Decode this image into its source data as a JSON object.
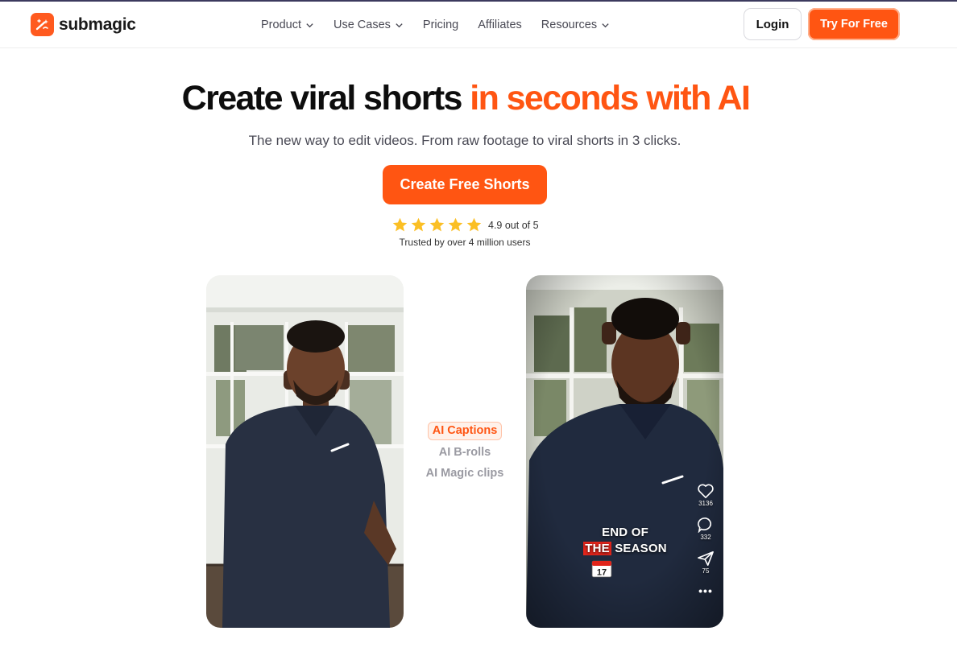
{
  "brand": {
    "name": "submagic",
    "accent": "#ff5512"
  },
  "nav": {
    "items": [
      {
        "label": "Product",
        "dropdown": true
      },
      {
        "label": "Use Cases",
        "dropdown": true
      },
      {
        "label": "Pricing",
        "dropdown": false
      },
      {
        "label": "Affiliates",
        "dropdown": false
      },
      {
        "label": "Resources",
        "dropdown": true
      }
    ],
    "login_label": "Login",
    "try_label": "Try For Free"
  },
  "hero": {
    "title_main": "Create viral shorts",
    "title_accent": "in seconds with AI",
    "subtitle": "The new way to edit videos. From raw footage to viral shorts in 3 clicks.",
    "cta_label": "Create Free Shorts",
    "rating_text": "4.9 out of 5",
    "stars": 5,
    "trusted_text": "Trusted by over 4 million users"
  },
  "features": {
    "active": "AI Captions",
    "items": [
      "AI B-rolls",
      "AI Magic clips"
    ]
  },
  "video_right": {
    "caption_line1": "END OF",
    "caption_highlight": "THE",
    "caption_line2_rest": "SEASON",
    "calendar_day": "17",
    "likes": "3136",
    "comments": "332",
    "shares": "75",
    "more": "•••"
  }
}
